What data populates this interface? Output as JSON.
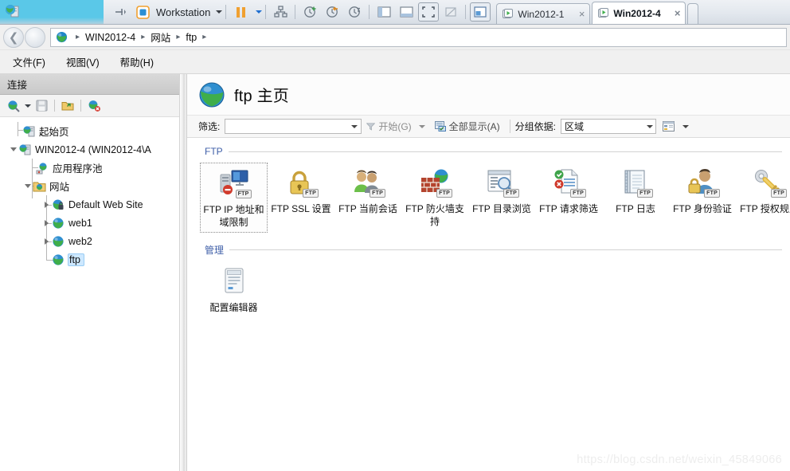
{
  "vmware": {
    "app_icon": "vmware-app-icon",
    "pin_icon": "pin-icon",
    "vm_icon": "vm-library-icon",
    "product_label": "Workstation",
    "pause_icon": "pause-icon",
    "toolbar_icons": [
      "send-ctrl-alt-del-icon",
      "snapshot-take-icon",
      "snapshot-revert-icon",
      "snapshot-manager-icon",
      "show-library-icon",
      "show-thumbnails-icon",
      "full-screen-icon",
      "unity-mode-icon",
      "console-view-icon"
    ],
    "tabs": [
      {
        "label": "Win2012-1",
        "active": false,
        "close_label": "×"
      },
      {
        "label": "Win2012-4",
        "active": true,
        "close_label": "×"
      }
    ]
  },
  "address_bar": {
    "back_icon": "back-arrow-icon",
    "forward_icon": "forward-arrow-icon",
    "site_icon": "globe-icon",
    "breadcrumbs": [
      "WIN2012-4",
      "网站",
      "ftp"
    ],
    "separator": "▸"
  },
  "menu": {
    "items": [
      "文件(F)",
      "视图(V)",
      "帮助(H)"
    ]
  },
  "sidebar": {
    "header": "连接",
    "toolbar_icons": [
      "connect-to-server-icon",
      "save-connection-icon",
      "open-connection-icon",
      "delete-connection-icon"
    ],
    "tree": [
      {
        "label": "起始页",
        "icon": "start-page-icon",
        "depth": 0,
        "expander": "none",
        "selected": false
      },
      {
        "label": "WIN2012-4 (WIN2012-4\\A",
        "icon": "server-icon",
        "depth": 0,
        "expander": "down",
        "selected": false
      },
      {
        "label": "应用程序池",
        "icon": "app-pools-icon",
        "depth": 1,
        "expander": "none",
        "selected": false
      },
      {
        "label": "网站",
        "icon": "sites-folder-icon",
        "depth": 1,
        "expander": "down",
        "selected": false
      },
      {
        "label": "Default Web Site",
        "icon": "web-site-lock-icon",
        "depth": 2,
        "expander": "right",
        "selected": false
      },
      {
        "label": "web1",
        "icon": "web-site-icon",
        "depth": 2,
        "expander": "right",
        "selected": false
      },
      {
        "label": "web2",
        "icon": "web-site-icon",
        "depth": 2,
        "expander": "right",
        "selected": false
      },
      {
        "label": "ftp",
        "icon": "web-site-icon",
        "depth": 2,
        "expander": "none",
        "selected": true
      }
    ]
  },
  "content": {
    "page_icon": "globe-icon",
    "title": "ftp 主页",
    "filter_bar": {
      "filter_label": "筛选:",
      "filter_value": "",
      "go_label": "开始(G)",
      "go_icon": "funnel-icon",
      "show_all_label": "全部显示(A)",
      "show_all_icon": "show-all-icon",
      "group_by_label": "分组依据:",
      "group_by_value": "区域",
      "view_icon": "view-mode-icon"
    },
    "groups": [
      {
        "title": "FTP",
        "items": [
          {
            "label": "FTP IP 地址和域限制",
            "icon": "ftp-ip-domain-restrictions-icon",
            "selected": true
          },
          {
            "label": "FTP SSL 设置",
            "icon": "ftp-ssl-settings-icon",
            "selected": false
          },
          {
            "label": "FTP 当前会话",
            "icon": "ftp-current-sessions-icon",
            "selected": false
          },
          {
            "label": "FTP 防火墙支持",
            "icon": "ftp-firewall-support-icon",
            "selected": false
          },
          {
            "label": "FTP 目录浏览",
            "icon": "ftp-directory-browsing-icon",
            "selected": false
          },
          {
            "label": "FTP 请求筛选",
            "icon": "ftp-request-filtering-icon",
            "selected": false
          },
          {
            "label": "FTP 日志",
            "icon": "ftp-logging-icon",
            "selected": false
          },
          {
            "label": "FTP 身份验证",
            "icon": "ftp-authentication-icon",
            "selected": false
          },
          {
            "label": "FTP 授权规则",
            "icon": "ftp-authorization-rules-icon",
            "selected": false
          }
        ]
      },
      {
        "title": "管理",
        "items": [
          {
            "label": "配置编辑器",
            "icon": "configuration-editor-icon",
            "selected": false
          }
        ]
      }
    ],
    "watermark": "https://blog.csdn.net/weixin_45849066"
  },
  "colors": {
    "vm_cyan": "#5ac8e8",
    "accent_blue": "#3f5fa8",
    "selection_blue": "#cde8ff",
    "pause_orange": "#f0a030"
  }
}
